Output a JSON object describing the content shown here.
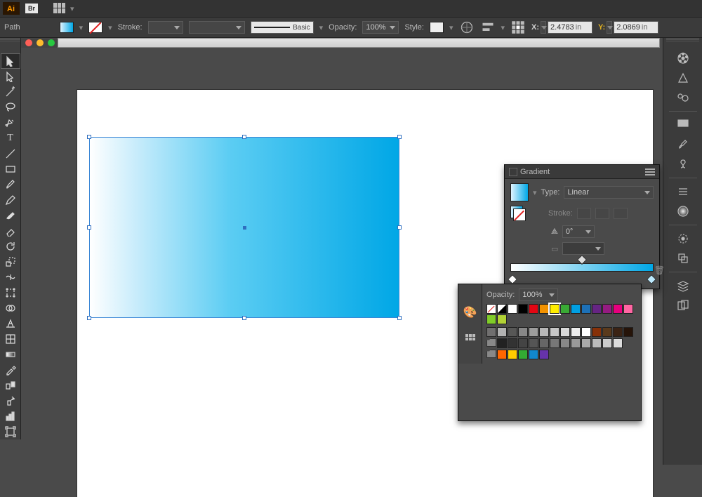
{
  "app": {
    "name": "Ai",
    "bridge_badge": "Br"
  },
  "options": {
    "selection_label": "Path",
    "stroke_label": "Stroke:",
    "stroke_weight": "",
    "brush_label": "Basic",
    "opacity_label": "Opacity:",
    "opacity_value": "100%",
    "style_label": "Style:",
    "x_label": "X:",
    "x_value": "2.4783",
    "x_unit": "in",
    "y_label": "Y:",
    "y_value": "2.0869",
    "y_unit": "in"
  },
  "gradient_panel": {
    "title": "Gradient",
    "type_label": "Type:",
    "type_value": "Linear",
    "stroke_label": "Stroke:",
    "angle_value": "0°"
  },
  "swatches_panel": {
    "opacity_label": "Opacity:",
    "opacity_value": "100%",
    "colors_row1": [
      "#ffffff",
      "#000000",
      "#e30613",
      "#f39200",
      "#ffed00",
      "#3aaa35",
      "#009fe3",
      "#1d71b8",
      "#662483",
      "#951b81",
      "#e6007e",
      "#ff66a3",
      "#80cc28",
      "#b2d235"
    ],
    "colors_row2": [
      "#706f6f",
      "#b2b2b2",
      "#575756",
      "#878787",
      "#9d9d9c",
      "#b7b7b7",
      "#c6c6c6",
      "#dadada",
      "#ededed",
      "#ffffff",
      "#873108",
      "#5a3a1c",
      "#3b2314",
      "#261409"
    ],
    "colors_gray": [
      "#222",
      "#333",
      "#444",
      "#555",
      "#666",
      "#777",
      "#888",
      "#999",
      "#aaa",
      "#bbb",
      "#ccc",
      "#ddd"
    ],
    "colors_row3": [
      "#ff6600",
      "#ffcc00",
      "#33aa33",
      "#1188cc",
      "#6633aa"
    ]
  }
}
